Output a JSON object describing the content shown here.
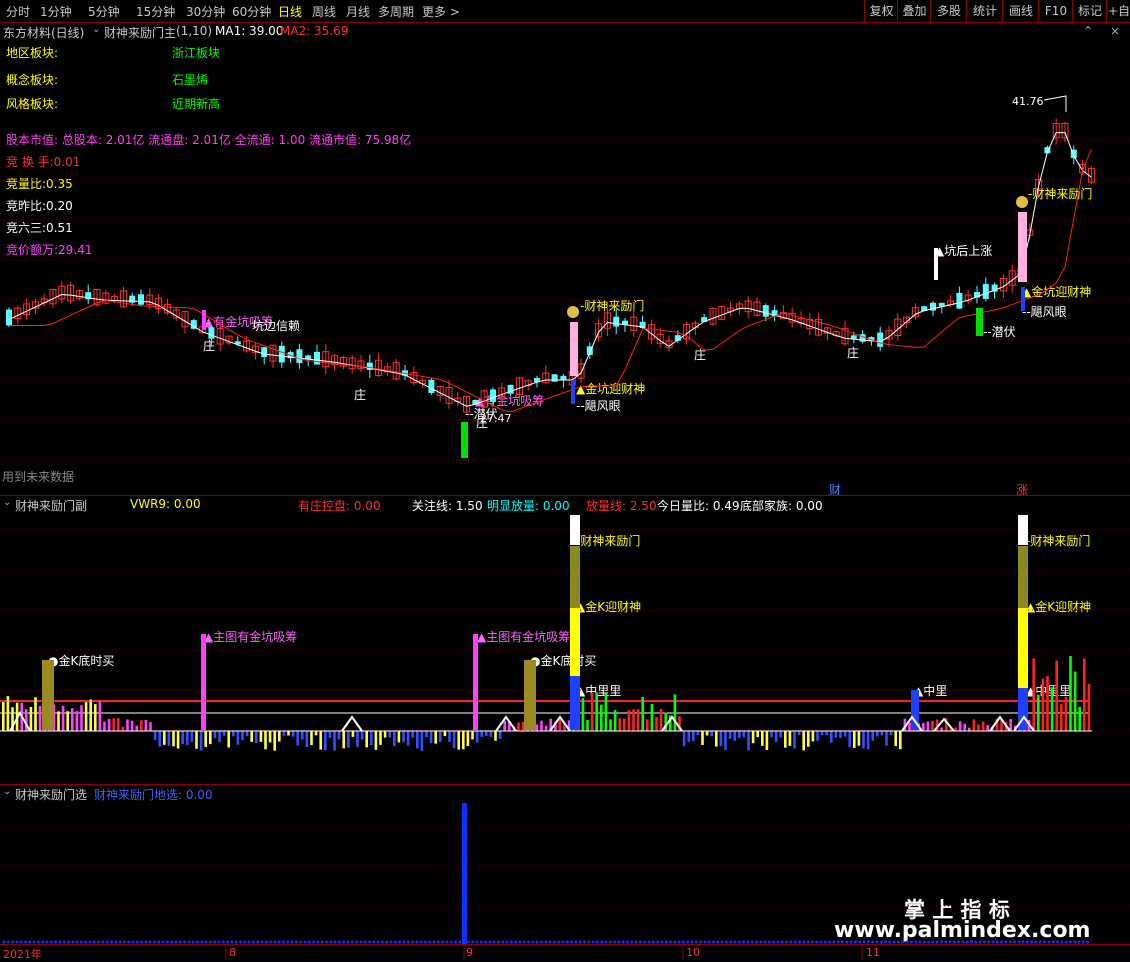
{
  "toolbar": {
    "periods": [
      "分时",
      "1分钟",
      "5分钟",
      "15分钟",
      "30分钟",
      "60分钟",
      "日线",
      "周线",
      "月线",
      "多周期",
      "更多 >"
    ],
    "active_period": "日线",
    "right_buttons": [
      "复权",
      "叠加",
      "多股",
      "统计",
      "画线",
      "F10",
      "标记",
      "+自"
    ]
  },
  "main_chart": {
    "stock_title": "东方材料(日线)",
    "indicator_name": "财神来励门主",
    "indicator_params": "(1,10)",
    "ma1_label": "MA1: 39.00",
    "ma2_label": "MA2: 35.69",
    "info_rows": [
      {
        "label": "地区板块:",
        "value": "浙江板块"
      },
      {
        "label": "概念板块:",
        "value": "石墨烯"
      },
      {
        "label": "风格板块:",
        "value": "近期新高"
      }
    ],
    "capital_line": "股本市值: 总股本: 2.01亿 流通盘: 2.01亿 全流通: 1.00 流通市值: 75.98亿",
    "stats": [
      {
        "text": "竞 换 手:0.01",
        "color": "#ff3030"
      },
      {
        "text": "竞量比:0.35",
        "color": "#ffff00"
      },
      {
        "text": "竞昨比:0.20",
        "color": "#ffffff"
      },
      {
        "text": "竞六三:0.51",
        "color": "#ffffff"
      },
      {
        "text": "竞价额万:29.41",
        "color": "#ff40ff"
      }
    ],
    "high_label": "41.76",
    "low_label": "27.47",
    "future_note": "用到未来数据",
    "annotations": [
      {
        "text": "有金坑吸筹",
        "color": "#ff60ff"
      },
      {
        "text": "坑边信赖",
        "color": "#ffffff"
      },
      {
        "text": "庄",
        "color": "#ffffff"
      },
      {
        "text": "庄",
        "color": "#ffffff"
      },
      {
        "text": "有金坑吸筹",
        "color": "#ff60ff"
      },
      {
        "text": "潜伏",
        "color": "#ffffff"
      },
      {
        "text": "庄",
        "color": "#ffffff"
      },
      {
        "text": "财神来励门",
        "color": "#ffff00"
      },
      {
        "text": "金坑迎财神",
        "color": "#ffff00"
      },
      {
        "text": "飓风眼",
        "color": "#ffffff"
      },
      {
        "text": "庄",
        "color": "#ffffff"
      },
      {
        "text": "庄",
        "color": "#ffffff"
      },
      {
        "text": "坑后上涨",
        "color": "#ffffff"
      },
      {
        "text": "潜伏",
        "color": "#ffffff"
      },
      {
        "text": "财神来励门",
        "color": "#ffff00"
      },
      {
        "text": "金坑迎财神",
        "color": "#ffff00"
      },
      {
        "text": "飓风眼",
        "color": "#ffffff"
      }
    ],
    "bottom_markers": [
      {
        "text": "财",
        "color": "#4080ff"
      },
      {
        "text": "涨",
        "color": "#ff3030"
      }
    ]
  },
  "sub_chart1": {
    "title": "财神来励门副",
    "items": [
      {
        "text": "VWR9: 0.00",
        "color": "#ffff00"
      },
      {
        "text": "有庄控盘: 0.00",
        "color": "#ff3030"
      },
      {
        "text": "关注线: 1.50",
        "color": "#ffffff"
      },
      {
        "text": "明显放量: 0.00",
        "color": "#00ffff"
      },
      {
        "text": "放量线: 2.50",
        "color": "#ff3030"
      },
      {
        "text": "今日量比: 0.49",
        "color": "#ffffff"
      },
      {
        "text": "底部家族: 0.00",
        "color": "#ffffff"
      }
    ],
    "annotations": [
      {
        "text": "金K底时买",
        "color": "#ffffff"
      },
      {
        "text": "主图有金坑吸筹",
        "color": "#ff60ff"
      },
      {
        "text": "主图有金坑吸筹",
        "color": "#ff60ff"
      },
      {
        "text": "金K底时买",
        "color": "#ffffff"
      },
      {
        "text": "财神来励门",
        "color": "#ffff00"
      },
      {
        "text": "金K迎财神",
        "color": "#ffff00"
      },
      {
        "text": "中里里",
        "color": "#ffffff"
      },
      {
        "text": "中里",
        "color": "#ffffff"
      },
      {
        "text": "财神来励门",
        "color": "#ffff00"
      },
      {
        "text": "金K迎财神",
        "color": "#ffff00"
      },
      {
        "text": "中里里",
        "color": "#ffffff"
      }
    ]
  },
  "sub_chart2": {
    "title": "财神来励门选",
    "item": "财神来励门地选: 0.00"
  },
  "time_axis": [
    "2021年",
    "8",
    "9",
    "10",
    "11"
  ],
  "watermark": {
    "cn": "掌 上 指 标",
    "url": "www.palmindex.com"
  }
}
